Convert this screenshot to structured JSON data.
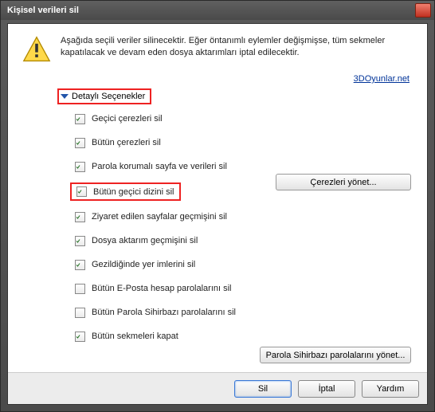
{
  "window": {
    "title": "Kişisel verileri sil"
  },
  "header": {
    "warning_text": "Aşağıda seçili veriler silinecektir. Eğer öntanımlı eylemler değişmişse, tüm sekmeler kapatılacak ve devam eden dosya aktarımları iptal edilecektir.",
    "site_link": "3DOyunlar.net"
  },
  "details": {
    "title": "Detaylı Seçenekler"
  },
  "options": [
    {
      "label": "Geçici çerezleri sil",
      "checked": true
    },
    {
      "label": "Bütün çerezleri sil",
      "checked": true
    },
    {
      "label": "Parola korumalı sayfa ve verileri sil",
      "checked": true
    },
    {
      "label": "Bütün geçici dizini sil",
      "checked": true,
      "highlight": true
    },
    {
      "label": "Ziyaret edilen sayfalar geçmişini sil",
      "checked": true
    },
    {
      "label": "Dosya aktarım geçmişini sil",
      "checked": true
    },
    {
      "label": "Gezildiğinde yer imlerini sil",
      "checked": true
    },
    {
      "label": "Bütün E-Posta hesap parolalarını sil",
      "checked": false
    },
    {
      "label": "Bütün Parola Sihirbazı parolalarını sil",
      "checked": false
    },
    {
      "label": "Bütün sekmeleri kapat",
      "checked": true
    }
  ],
  "side_buttons": {
    "manage_cookies": "Çerezleri yönet...",
    "manage_wand": "Parola Sihirbazı parolalarını yönet..."
  },
  "footer": {
    "delete": "Sil",
    "cancel": "İptal",
    "help": "Yardım"
  }
}
